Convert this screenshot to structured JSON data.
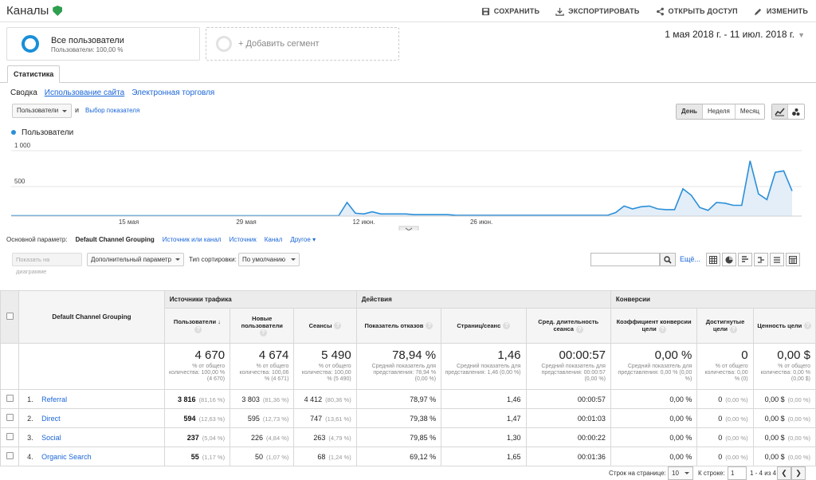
{
  "header": {
    "title": "Каналы",
    "actions": [
      "СОХРАНИТЬ",
      "ЭКСПОРТИРОВАТЬ",
      "ОТКРЫТЬ ДОСТУП",
      "ИЗМЕНИТЬ"
    ]
  },
  "segments": {
    "active": {
      "name": "Все пользователи",
      "sub": "Пользователи: 100,00 %"
    },
    "add": "+ Добавить сегмент"
  },
  "date_range": "1 мая 2018 г. - 11 июл. 2018 г.",
  "tab": "Статистика",
  "subtabs": [
    "Сводка",
    "Использование сайта",
    "Электронная торговля"
  ],
  "metric": {
    "selected": "Пользователи",
    "and": "и",
    "picker": "Выбор показателя"
  },
  "granularity": [
    "День",
    "Неделя",
    "Месяц"
  ],
  "chart_data": {
    "type": "line",
    "series_name": "Пользователи",
    "y_ticks": [
      "1 000",
      "500"
    ],
    "ylim": [
      0,
      1000
    ],
    "x_ticks": [
      "15 мая",
      "29 мая",
      "12 июн.",
      "26 июн."
    ],
    "values": [
      6,
      6,
      6,
      6,
      6,
      6,
      6,
      6,
      6,
      6,
      6,
      6,
      6,
      6,
      6,
      6,
      6,
      6,
      6,
      6,
      6,
      6,
      6,
      6,
      6,
      6,
      6,
      6,
      6,
      6,
      6,
      6,
      6,
      6,
      6,
      6,
      6,
      6,
      6,
      6,
      190,
      40,
      30,
      60,
      30,
      30,
      30,
      30,
      20,
      20,
      20,
      20,
      20,
      10,
      10,
      10,
      10,
      10,
      10,
      10,
      10,
      10,
      10,
      10,
      10,
      10,
      10,
      10,
      10,
      10,
      10,
      10,
      50,
      140,
      100,
      130,
      140,
      100,
      90,
      90,
      380,
      290,
      120,
      80,
      190,
      180,
      150,
      150,
      770,
      310,
      230,
      610,
      630,
      350
    ]
  },
  "primary_dim": {
    "label": "Основной параметр:",
    "current": "Default Channel Grouping",
    "options": [
      "Источник или канал",
      "Источник",
      "Канал",
      "Другое"
    ]
  },
  "toolbar": {
    "plot_rows": "Показать на диаграмме",
    "secondary": "Дополнительный параметр",
    "sort_label": "Тип сортировки:",
    "sort_value": "По умолчанию",
    "more": "Ещё..."
  },
  "table": {
    "dim_header": "Default Channel Grouping",
    "groups": [
      "Источники трафика",
      "Действия",
      "Конверсии"
    ],
    "columns": [
      "Пользователи",
      "Новые пользователи",
      "Сеансы",
      "Показатель отказов",
      "Страниц/сеанс",
      "Сред. длительность сеанса",
      "Коэффициент конверсии цели",
      "Достигнутые цели",
      "Ценность цели"
    ],
    "totals": [
      {
        "v": "4 670",
        "s": "% от общего количества: 100,00 % (4 670)"
      },
      {
        "v": "4 674",
        "s": "% от общего количества: 100,06 % (4 671)"
      },
      {
        "v": "5 490",
        "s": "% от общего количества: 100,00 % (5 490)"
      },
      {
        "v": "78,94 %",
        "s": "Средний показатель для представления: 78,94 % (0,00 %)"
      },
      {
        "v": "1,46",
        "s": "Средний показатель для представления: 1,46 (0,00 %)"
      },
      {
        "v": "00:00:57",
        "s": "Средний показатель для представления: 00:00:57 (0,00 %)"
      },
      {
        "v": "0,00 %",
        "s": "Средний показатель для представления: 0,00 % (0,00 %)"
      },
      {
        "v": "0",
        "s": "% от общего количества: 0,00 % (0)"
      },
      {
        "v": "0,00 $",
        "s": "% от общего количества: 0,00 % (0,00 $)"
      }
    ],
    "rows": [
      {
        "idx": "1.",
        "name": "Referral",
        "users": "3 816",
        "users_pct": "(81,16 %)",
        "new": "3 803",
        "new_pct": "(81,36 %)",
        "sess": "4 412",
        "sess_pct": "(80,36 %)",
        "bounce": "78,97 %",
        "pps": "1,46",
        "dur": "00:00:57",
        "cr": "0,00 %",
        "goals": "0",
        "goals_pct": "(0,00 %)",
        "val": "0,00 $",
        "val_pct": "(0,00 %)"
      },
      {
        "idx": "2.",
        "name": "Direct",
        "users": "594",
        "users_pct": "(12,63 %)",
        "new": "595",
        "new_pct": "(12,73 %)",
        "sess": "747",
        "sess_pct": "(13,61 %)",
        "bounce": "79,38 %",
        "pps": "1,47",
        "dur": "00:01:03",
        "cr": "0,00 %",
        "goals": "0",
        "goals_pct": "(0,00 %)",
        "val": "0,00 $",
        "val_pct": "(0,00 %)"
      },
      {
        "idx": "3.",
        "name": "Social",
        "users": "237",
        "users_pct": "(5,04 %)",
        "new": "226",
        "new_pct": "(4,84 %)",
        "sess": "263",
        "sess_pct": "(4,79 %)",
        "bounce": "79,85 %",
        "pps": "1,30",
        "dur": "00:00:22",
        "cr": "0,00 %",
        "goals": "0",
        "goals_pct": "(0,00 %)",
        "val": "0,00 $",
        "val_pct": "(0,00 %)"
      },
      {
        "idx": "4.",
        "name": "Organic Search",
        "users": "55",
        "users_pct": "(1,17 %)",
        "new": "50",
        "new_pct": "(1,07 %)",
        "sess": "68",
        "sess_pct": "(1,24 %)",
        "bounce": "69,12 %",
        "pps": "1,65",
        "dur": "00:01:36",
        "cr": "0,00 %",
        "goals": "0",
        "goals_pct": "(0,00 %)",
        "val": "0,00 $",
        "val_pct": "(0,00 %)"
      }
    ]
  },
  "footer": {
    "rows_label": "Строк на странице:",
    "rows_value": "10",
    "goto_label": "К строке:",
    "goto_value": "1",
    "range": "1 - 4 из 4"
  },
  "colors": {
    "accent": "#1a8fd8",
    "line": "#2b8fd8",
    "verified": "#2e9e4f"
  }
}
